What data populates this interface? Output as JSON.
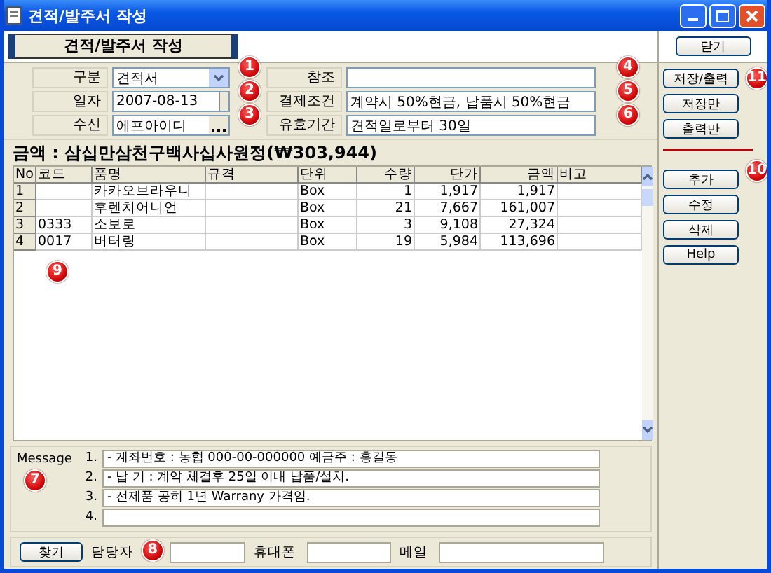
{
  "window": {
    "title": "견적/발주서 작성"
  },
  "header": {
    "title": "견적/발주서 작성",
    "close_button": "닫기"
  },
  "form_left": [
    {
      "label": "구분",
      "value": "견적서",
      "kind": "dropdown"
    },
    {
      "label": "일자",
      "value": "2007-08-13",
      "kind": "date"
    },
    {
      "label": "수신",
      "value": "에프아이디",
      "kind": "lookup"
    }
  ],
  "form_right": [
    {
      "label": "참조"
    },
    {
      "label": "결제조건",
      "value": "계약시 50%현금, 납품시 50%현금"
    },
    {
      "label": "유효기간",
      "value": "견적일로부터 30일"
    }
  ],
  "amount": "금액 : 삼십만삼천구백사십사원정(₩303,944)",
  "table": {
    "columns": [
      "No",
      "코드",
      "품명",
      "규격",
      "단위",
      "수량",
      "단가",
      "금액",
      "비고"
    ],
    "rows": [
      {
        "no": "1",
        "name": "카카오브라우니",
        "unit": "Box",
        "qty": "1",
        "price": "1,917",
        "amount": "1,917"
      },
      {
        "no": "2",
        "name": "후렌치어니언",
        "unit": "Box",
        "qty": "21",
        "price": "7,667",
        "amount": "161,007"
      },
      {
        "no": "3",
        "code": "0333",
        "name": "소보로",
        "unit": "Box",
        "qty": "3",
        "price": "9,108",
        "amount": "27,324"
      },
      {
        "no": "4",
        "code": "0017",
        "name": "버터링",
        "unit": "Box",
        "qty": "19",
        "price": "5,984",
        "amount": "113,696"
      }
    ]
  },
  "message": {
    "label": "Message",
    "lines": [
      {
        "number": "1.",
        "text": "- 계좌번호 : 농협 000-00-000000  예금주 : 홍길동"
      },
      {
        "number": "2.",
        "text": "- 납 기 : 계약 체결후 25일 이내 납품/설치."
      },
      {
        "number": "3.",
        "text": "- 전제품 공히 1년 Warrany 가격임."
      },
      {
        "number": "4."
      }
    ]
  },
  "contact": {
    "find_button": "찾기",
    "fields": [
      {
        "label": "담당자"
      },
      {
        "label": "휴대폰"
      },
      {
        "label": "메일"
      }
    ]
  },
  "output_buttons": [
    "저장/출력",
    "저장만",
    "출력만"
  ],
  "edit_buttons": [
    "추가",
    "수정",
    "삭제",
    "Help"
  ],
  "callouts": [
    "1",
    "2",
    "3",
    "4",
    "5",
    "6",
    "7",
    "8",
    "9",
    "10",
    "11"
  ]
}
